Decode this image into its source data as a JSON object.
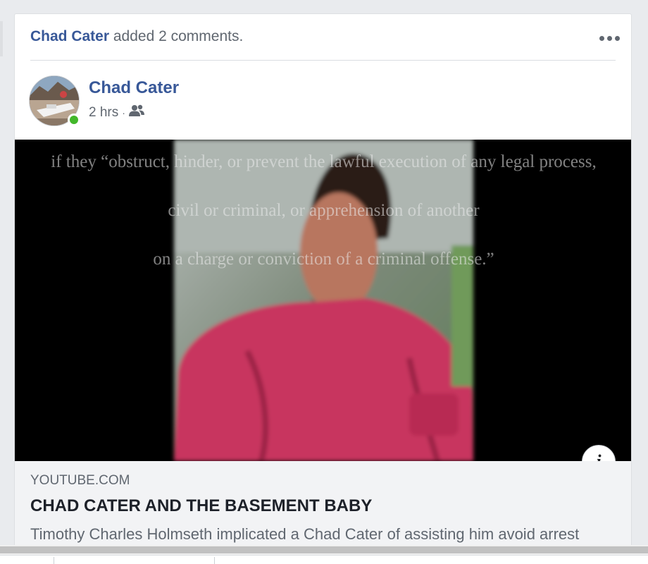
{
  "activity": {
    "actor": "Chad Cater",
    "action": "added 2 comments."
  },
  "post": {
    "author": "Chad Cater",
    "time": "2 hrs",
    "separator": "·",
    "audience_icon": "friends-icon",
    "online_status_color": "#42b72a"
  },
  "media": {
    "overlay_lines": [
      "if they “obstruct, hinder, or prevent the lawful execution of any legal process,",
      "civil or criminal, or apprehension of another",
      "on a charge or conviction of a criminal offense.”"
    ],
    "info_glyph": "i"
  },
  "link_preview": {
    "domain": "YOUTUBE.COM",
    "title": "CHAD CATER AND THE BASEMENT BABY",
    "description": "Timothy Charles Holmseth implicated a Chad Cater of assisting him avoid arrest"
  },
  "colors": {
    "link_blue": "#385898",
    "secondary_text": "#606770",
    "preview_bg": "#f2f3f5"
  }
}
